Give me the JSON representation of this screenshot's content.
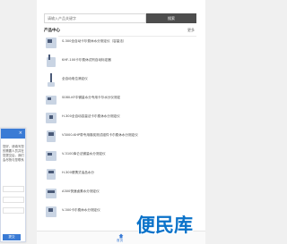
{
  "search": {
    "placeholder": "请输入产品关键字",
    "button_label": "搜索"
  },
  "section": {
    "title": "产品中心",
    "more_label": "更多"
  },
  "products": [
    {
      "name": "S-300全自动卡尔费休水分测定仪（容量法）"
    },
    {
      "name": "KHF-100卡尔费休试剂自动标定器"
    },
    {
      "name": "全自动电位滴定仪"
    },
    {
      "name": "S080-KF中微量水分专用卡尔水分仪测定"
    },
    {
      "name": "H-300全自动容量法卡尔费休水分测定仪"
    },
    {
      "name": "V3000-KHP带专用煤炭测试组件卡尔费休水分测定仪"
    },
    {
      "name": "V-3100库仑法微量水分测定仪"
    },
    {
      "name": "H-300便携式油品水分"
    },
    {
      "name": "A300快速卤素水分测定仪"
    },
    {
      "name": "V-300卡尔费休水分测定仪"
    }
  ],
  "side_panel": {
    "close_label": "×",
    "text": "您好，请填写您的需要人员并在您提交后，我们会尽快与您联系",
    "submit_label": "提交"
  },
  "bottom_bar": {
    "home_label": "首页"
  },
  "watermark": {
    "text": "便民库"
  }
}
